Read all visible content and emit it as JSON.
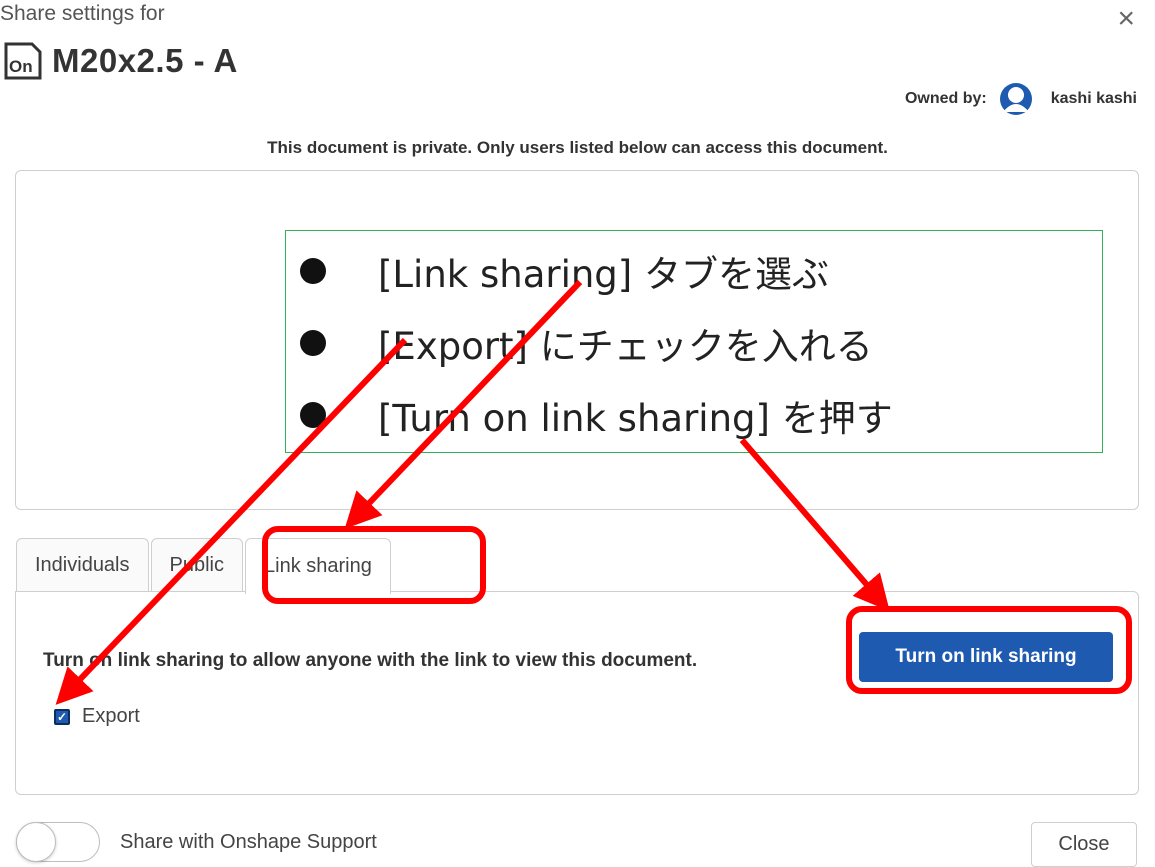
{
  "dialog": {
    "subtitle": "Share settings for",
    "close_glyph": "×",
    "doc_icon": "onshape-doc-icon",
    "doc_icon_text": "On",
    "title": "M20x2.5 - A",
    "owner_label": "Owned by:",
    "owner_name": "kashi kashi",
    "privacy_note": "This document is private. Only users listed below can access this document."
  },
  "tabs": [
    {
      "label": "Individuals",
      "active": false
    },
    {
      "label": "Public",
      "active": false
    },
    {
      "label": "Link sharing",
      "active": true
    }
  ],
  "panel": {
    "description": "Turn on link sharing to allow anyone with the link to view this document.",
    "primary_button": "Turn on link sharing",
    "export_label": "Export",
    "export_checked": true
  },
  "footer": {
    "toggle_label": "Share with Onshape Support",
    "toggle_on": false,
    "close_label": "Close"
  },
  "annotation": {
    "steps": [
      "[Link sharing] タブを選ぶ",
      "[Export] にチェックを入れる",
      "[Turn on link sharing] を押す"
    ],
    "highlight_color": "#ff0000",
    "box_border_color": "#33b05a"
  },
  "colors": {
    "primary": "#1f5ab1",
    "text": "#333333",
    "border": "#cfcfcf"
  }
}
